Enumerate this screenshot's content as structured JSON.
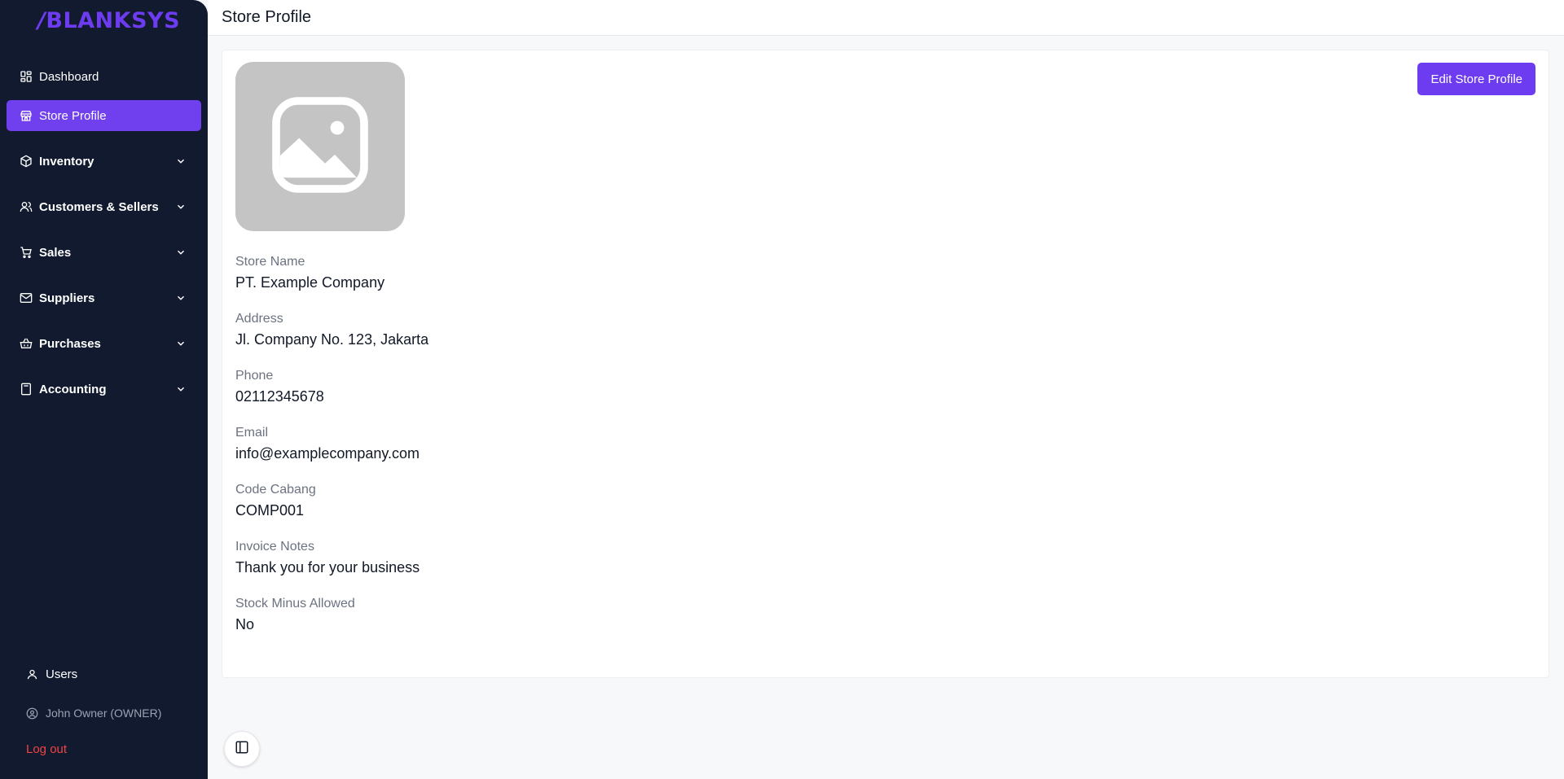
{
  "brand": {
    "logo_mark": "/",
    "logo_text": "BLANKSYS",
    "accent": "#6d3cf0"
  },
  "sidebar": {
    "items": [
      {
        "label": "Dashboard",
        "icon": "dashboard-icon"
      },
      {
        "label": "Store Profile",
        "icon": "store-icon",
        "active": true
      },
      {
        "label": "Inventory",
        "icon": "box-icon"
      },
      {
        "label": "Customers & Sellers",
        "icon": "users-icon"
      },
      {
        "label": "Sales",
        "icon": "cart-icon"
      },
      {
        "label": "Suppliers",
        "icon": "mail-icon"
      },
      {
        "label": "Purchases",
        "icon": "basket-icon"
      },
      {
        "label": "Accounting",
        "icon": "calculator-icon"
      }
    ],
    "users_label": "Users",
    "current_user": "John Owner (OWNER)",
    "logout_label": "Log out"
  },
  "header": {
    "title": "Store Profile"
  },
  "profile": {
    "edit_button": "Edit Store Profile",
    "image_icon": "image-placeholder-icon",
    "fields": [
      {
        "label": "Store Name",
        "value": "PT. Example Company"
      },
      {
        "label": "Address",
        "value": "Jl. Company No. 123, Jakarta"
      },
      {
        "label": "Phone",
        "value": "02112345678"
      },
      {
        "label": "Email",
        "value": "info@examplecompany.com"
      },
      {
        "label": "Code Cabang",
        "value": "COMP001"
      },
      {
        "label": "Invoice Notes",
        "value": "Thank you for your business"
      },
      {
        "label": "Stock Minus Allowed",
        "value": "No"
      }
    ]
  },
  "colors": {
    "sidebar_bg": "#111a2e",
    "active_bg": "#7040ee",
    "logout": "#ef4444"
  }
}
